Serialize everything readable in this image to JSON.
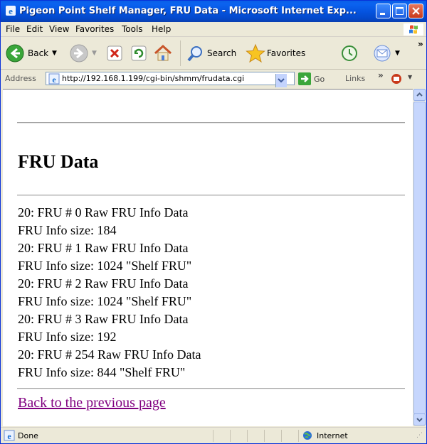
{
  "window": {
    "title": "Pigeon Point Shelf Manager, FRU Data - Microsoft Internet Exp...",
    "accent_color": "#0554e0"
  },
  "menu": [
    "File",
    "Edit",
    "View",
    "Favorites",
    "Tools",
    "Help"
  ],
  "toolbar": {
    "back_label": "Back",
    "search_label": "Search",
    "favorites_label": "Favorites"
  },
  "address": {
    "label": "Address",
    "url": "http://192.168.1.199/cgi-bin/shmm/frudata.cgi",
    "go_label": "Go",
    "links_label": "Links"
  },
  "page": {
    "heading": "FRU Data",
    "lines": [
      "20: FRU # 0 Raw FRU Info Data",
      "FRU Info size: 184",
      "20: FRU # 1 Raw FRU Info Data",
      "FRU Info size: 1024 \"Shelf FRU\"",
      "20: FRU # 2 Raw FRU Info Data",
      "FRU Info size: 1024 \"Shelf FRU\"",
      "20: FRU # 3 Raw FRU Info Data",
      "FRU Info size: 192",
      "20: FRU # 254 Raw FRU Info Data",
      "FRU Info size: 844 \"Shelf FRU\""
    ],
    "back_link": "Back to the previous page"
  },
  "status": {
    "text": "Done",
    "zone": "Internet"
  }
}
